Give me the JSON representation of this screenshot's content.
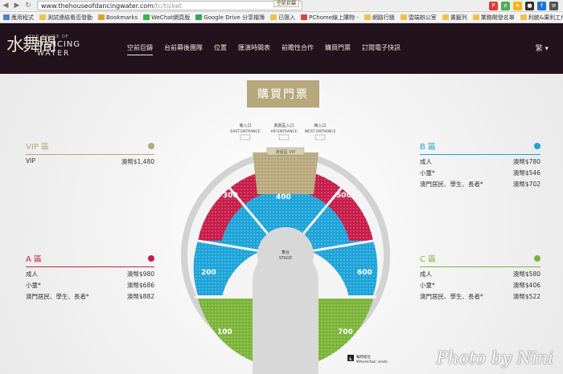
{
  "browser": {
    "url_host": "www.thehouseofdancingwater.com",
    "url_path": "/tc/ticket",
    "tooltip": "空前巨鑄",
    "bookmarks": [
      {
        "label": "應用程式",
        "color": "#4a7fd4"
      },
      {
        "label": "測試連結看否發動",
        "color": "#f0c24b"
      },
      {
        "label": "Bookmarks",
        "color": "#e0a030"
      },
      {
        "label": "WeChat網頁版",
        "color": "#3bb44a"
      },
      {
        "label": "Google Drive 分享檔簿",
        "color": "#34a853"
      },
      {
        "label": "已匯入",
        "color": "#f0c24b"
      },
      {
        "label": "PChome線上購物 -",
        "color": "#d9463c"
      },
      {
        "label": "網路行銷",
        "color": "#f0c24b"
      },
      {
        "label": "雲端辦公室",
        "color": "#f0c24b"
      },
      {
        "label": "書籤列",
        "color": "#f0c24b"
      },
      {
        "label": "業務開發名單",
        "color": "#f0c24b"
      },
      {
        "label": "利統&果利工作書籤",
        "color": "#f0c24b"
      }
    ]
  },
  "site": {
    "logo_chinese": "水舞間",
    "logo_small": "THE HOUSE OF",
    "logo_line1": "DANCING",
    "logo_line2": "WATER",
    "nav": [
      "空前巨鑄",
      "台前幕後團隊",
      "位置",
      "匯演時間表",
      "前瞻性合作",
      "購買門票",
      "訂閱電子快訊"
    ],
    "lang": "繁"
  },
  "page": {
    "title": "購買門票",
    "watermark": "Photo by Nini",
    "zones": {
      "vip": {
        "title": "VIP 區",
        "color": "#b7a77d",
        "rows": [
          {
            "label": "VIP",
            "price": "澳幣$1,480"
          }
        ]
      },
      "a": {
        "title": "A 區",
        "color": "#c41e4a",
        "rows": [
          {
            "label": "成人",
            "price": "澳幣$980"
          },
          {
            "label": "小童*",
            "price": "澳幣$686"
          },
          {
            "label": "澳門居民、學生、長者*",
            "price": "澳幣$882"
          }
        ]
      },
      "b": {
        "title": "B 區",
        "color": "#1ea3d8",
        "rows": [
          {
            "label": "成人",
            "price": "澳幣$780"
          },
          {
            "label": "小童*",
            "price": "澳幣$546"
          },
          {
            "label": "澳門居民、學生、長者*",
            "price": "澳幣$702"
          }
        ]
      },
      "c": {
        "title": "C 區",
        "color": "#7ab33a",
        "rows": [
          {
            "label": "成人",
            "price": "澳幣$580"
          },
          {
            "label": "小童*",
            "price": "澳幣$406"
          },
          {
            "label": "澳門居民、學生、長者*",
            "price": "澳幣$522"
          }
        ]
      }
    },
    "map": {
      "east_entrance": "東入口",
      "east_entrance_en": "EAST ENTRANCE",
      "vip_entrance": "貴賓區入口",
      "vip_entrance_en": "VIP ENTRANCE",
      "west_entrance": "西入口",
      "west_entrance_en": "WEST ENTRANCE",
      "vip_box": "貴賓區 VIP",
      "stage": "舞台",
      "stage_en": "STAGE",
      "sections": [
        "300",
        "400",
        "500",
        "200",
        "600",
        "100",
        "700"
      ],
      "wheelchair": "輪椅座位",
      "wheelchair_en": "Wheelchair seats"
    }
  }
}
